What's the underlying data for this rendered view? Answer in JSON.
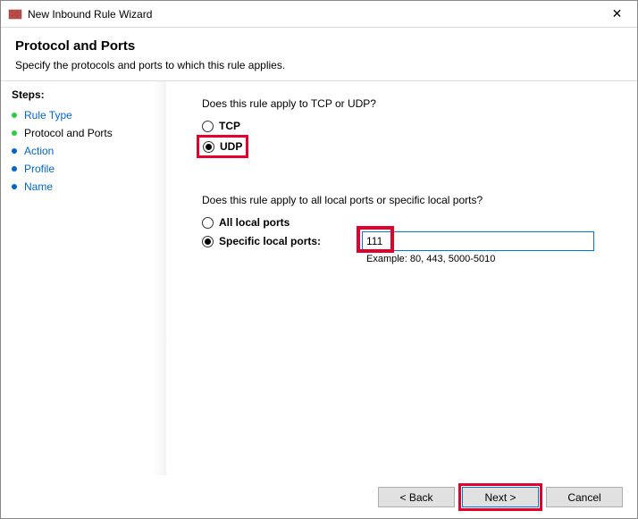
{
  "window": {
    "title": "New Inbound Rule Wizard",
    "close": "✕"
  },
  "header": {
    "title": "Protocol and Ports",
    "subtitle": "Specify the protocols and ports to which this rule applies."
  },
  "sidebar": {
    "steps_label": "Steps:",
    "items": [
      {
        "label": "Rule Type",
        "state": "done"
      },
      {
        "label": "Protocol and Ports",
        "state": "current"
      },
      {
        "label": "Action",
        "state": "todo"
      },
      {
        "label": "Profile",
        "state": "todo"
      },
      {
        "label": "Name",
        "state": "todo"
      }
    ]
  },
  "main": {
    "q1": "Does this rule apply to TCP or UDP?",
    "tcp_label": "TCP",
    "udp_label": "UDP",
    "protocol_selected": "UDP",
    "q2": "Does this rule apply to all local ports or specific local ports?",
    "all_ports_label": "All local ports",
    "specific_ports_label": "Specific local ports:",
    "ports_selected": "specific",
    "port_value": "111",
    "example": "Example: 80, 443, 5000-5010"
  },
  "footer": {
    "back": "< Back",
    "next": "Next >",
    "cancel": "Cancel"
  }
}
